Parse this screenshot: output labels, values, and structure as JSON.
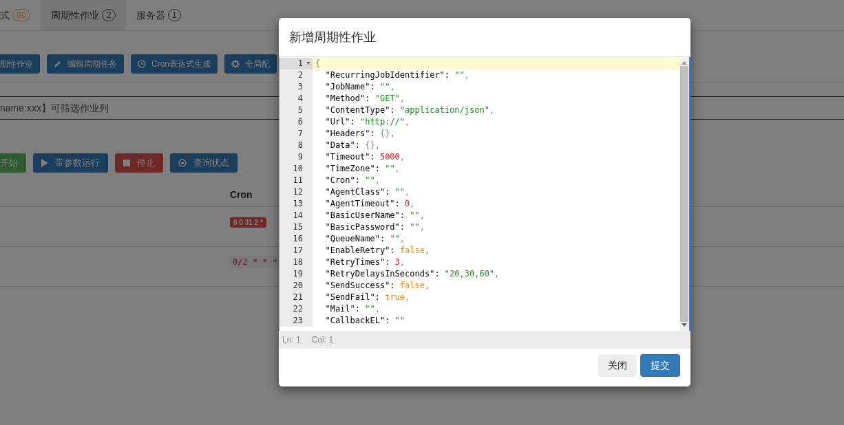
{
  "tabs": [
    {
      "label": "式",
      "badge": "90",
      "kind": "warning",
      "selected": false
    },
    {
      "label": "周期性作业",
      "badge": "2",
      "kind": "plain",
      "selected": true
    },
    {
      "label": "服务器",
      "badge": "1",
      "kind": "plain",
      "selected": false
    }
  ],
  "toolbar": [
    {
      "label": "期性作业"
    },
    {
      "label": "编辑周期任务",
      "kind": "edit"
    },
    {
      "label": "Cron表达式生成",
      "kind": "generate"
    },
    {
      "label": "全局配",
      "kind": "settings"
    }
  ],
  "search": {
    "value": "name:xxx】可筛选作业列"
  },
  "actions": [
    {
      "label": "开始",
      "kind": "start"
    },
    {
      "label": "带参数运行",
      "kind": "run"
    },
    {
      "label": "停止",
      "kind": "stop"
    },
    {
      "label": "查询状态",
      "kind": "query"
    }
  ],
  "table": {
    "columns": [
      "Cron"
    ],
    "rows": [
      {
        "cron": "0 0 31 2 *",
        "kind": "badge"
      },
      {
        "cron": "0/2 * * *",
        "kind": "code"
      }
    ]
  },
  "modal": {
    "title": "新增周期性作业",
    "editor": {
      "lines": [
        {
          "number": "1",
          "active": true,
          "foldable": true,
          "tokens": [
            {
              "kind": "brace",
              "text": "{"
            }
          ]
        },
        {
          "number": "2",
          "tokens": [
            {
              "kind": "key",
              "text": "  \"RecurringJobIdentifier\": "
            },
            {
              "kind": "string",
              "text": "\"\""
            },
            {
              "kind": "punct",
              "text": ","
            }
          ]
        },
        {
          "number": "3",
          "tokens": [
            {
              "kind": "key",
              "text": "  \"JobName\": "
            },
            {
              "kind": "string",
              "text": "\"\""
            },
            {
              "kind": "punct",
              "text": ","
            }
          ]
        },
        {
          "number": "4",
          "tokens": [
            {
              "kind": "key",
              "text": "  \"Method\": "
            },
            {
              "kind": "string",
              "text": "\"GET\""
            },
            {
              "kind": "punct",
              "text": ","
            }
          ]
        },
        {
          "number": "5",
          "tokens": [
            {
              "kind": "key",
              "text": "  \"ContentType\": "
            },
            {
              "kind": "string",
              "text": "\"application/json\""
            },
            {
              "kind": "punct",
              "text": ","
            }
          ]
        },
        {
          "number": "6",
          "tokens": [
            {
              "kind": "key",
              "text": "  \"Url\": "
            },
            {
              "kind": "string",
              "text": "\"http://\""
            },
            {
              "kind": "punct",
              "text": ","
            }
          ]
        },
        {
          "number": "7",
          "tokens": [
            {
              "kind": "key",
              "text": "  \"Headers\": "
            },
            {
              "kind": "brace",
              "text": "{}"
            },
            {
              "kind": "punct",
              "text": ","
            }
          ]
        },
        {
          "number": "8",
          "tokens": [
            {
              "kind": "key",
              "text": "  \"Data\": "
            },
            {
              "kind": "brace",
              "text": "{}"
            },
            {
              "kind": "punct",
              "text": ","
            }
          ]
        },
        {
          "number": "9",
          "tokens": [
            {
              "kind": "key",
              "text": "  \"Timeout\": "
            },
            {
              "kind": "number",
              "text": "5000"
            },
            {
              "kind": "punct",
              "text": ","
            }
          ]
        },
        {
          "number": "10",
          "tokens": [
            {
              "kind": "key",
              "text": "  \"TimeZone\": "
            },
            {
              "kind": "string",
              "text": "\"\""
            },
            {
              "kind": "punct",
              "text": ","
            }
          ]
        },
        {
          "number": "11",
          "tokens": [
            {
              "kind": "key",
              "text": "  \"Cron\": "
            },
            {
              "kind": "string",
              "text": "\"\""
            },
            {
              "kind": "punct",
              "text": ","
            }
          ]
        },
        {
          "number": "12",
          "tokens": [
            {
              "kind": "key",
              "text": "  \"AgentClass\": "
            },
            {
              "kind": "string",
              "text": "\"\""
            },
            {
              "kind": "punct",
              "text": ","
            }
          ]
        },
        {
          "number": "13",
          "tokens": [
            {
              "kind": "key",
              "text": "  \"AgentTimeout\": "
            },
            {
              "kind": "number",
              "text": "0"
            },
            {
              "kind": "punct",
              "text": ","
            }
          ]
        },
        {
          "number": "14",
          "tokens": [
            {
              "kind": "key",
              "text": "  \"BasicUserName\": "
            },
            {
              "kind": "string",
              "text": "\"\""
            },
            {
              "kind": "punct",
              "text": ","
            }
          ]
        },
        {
          "number": "15",
          "tokens": [
            {
              "kind": "key",
              "text": "  \"BasicPassword\": "
            },
            {
              "kind": "string",
              "text": "\"\""
            },
            {
              "kind": "punct",
              "text": ","
            }
          ]
        },
        {
          "number": "16",
          "tokens": [
            {
              "kind": "key",
              "text": "  \"QueueName\": "
            },
            {
              "kind": "string",
              "text": "\"\""
            },
            {
              "kind": "punct",
              "text": ","
            }
          ]
        },
        {
          "number": "17",
          "tokens": [
            {
              "kind": "key",
              "text": "  \"EnableRetry\": "
            },
            {
              "kind": "boolean",
              "text": "false"
            },
            {
              "kind": "punct",
              "text": ","
            }
          ]
        },
        {
          "number": "18",
          "tokens": [
            {
              "kind": "key",
              "text": "  \"RetryTimes\": "
            },
            {
              "kind": "number",
              "text": "3"
            },
            {
              "kind": "punct",
              "text": ","
            }
          ]
        },
        {
          "number": "19",
          "tokens": [
            {
              "kind": "key",
              "text": "  \"RetryDelaysInSeconds\": "
            },
            {
              "kind": "string",
              "text": "\"20,30,60\""
            },
            {
              "kind": "punct",
              "text": ","
            }
          ]
        },
        {
          "number": "20",
          "tokens": [
            {
              "kind": "key",
              "text": "  \"SendSuccess\": "
            },
            {
              "kind": "boolean",
              "text": "false"
            },
            {
              "kind": "punct",
              "text": ","
            }
          ]
        },
        {
          "number": "21",
          "tokens": [
            {
              "kind": "key",
              "text": "  \"SendFail\": "
            },
            {
              "kind": "boolean",
              "text": "true"
            },
            {
              "kind": "punct",
              "text": ","
            }
          ]
        },
        {
          "number": "22",
          "tokens": [
            {
              "kind": "key",
              "text": "  \"Mail\": "
            },
            {
              "kind": "string",
              "text": "\"\""
            },
            {
              "kind": "punct",
              "text": ","
            }
          ]
        },
        {
          "number": "23",
          "tokens": [
            {
              "kind": "key",
              "text": "  \"CallbackEL\": "
            },
            {
              "kind": "string",
              "text": "\"\""
            }
          ]
        }
      ]
    },
    "status": {
      "line": "Ln: 1",
      "col": "Col: 1"
    },
    "buttons": [
      {
        "label": "关闭",
        "kind": "default"
      },
      {
        "label": "提交",
        "kind": "primary"
      }
    ]
  }
}
